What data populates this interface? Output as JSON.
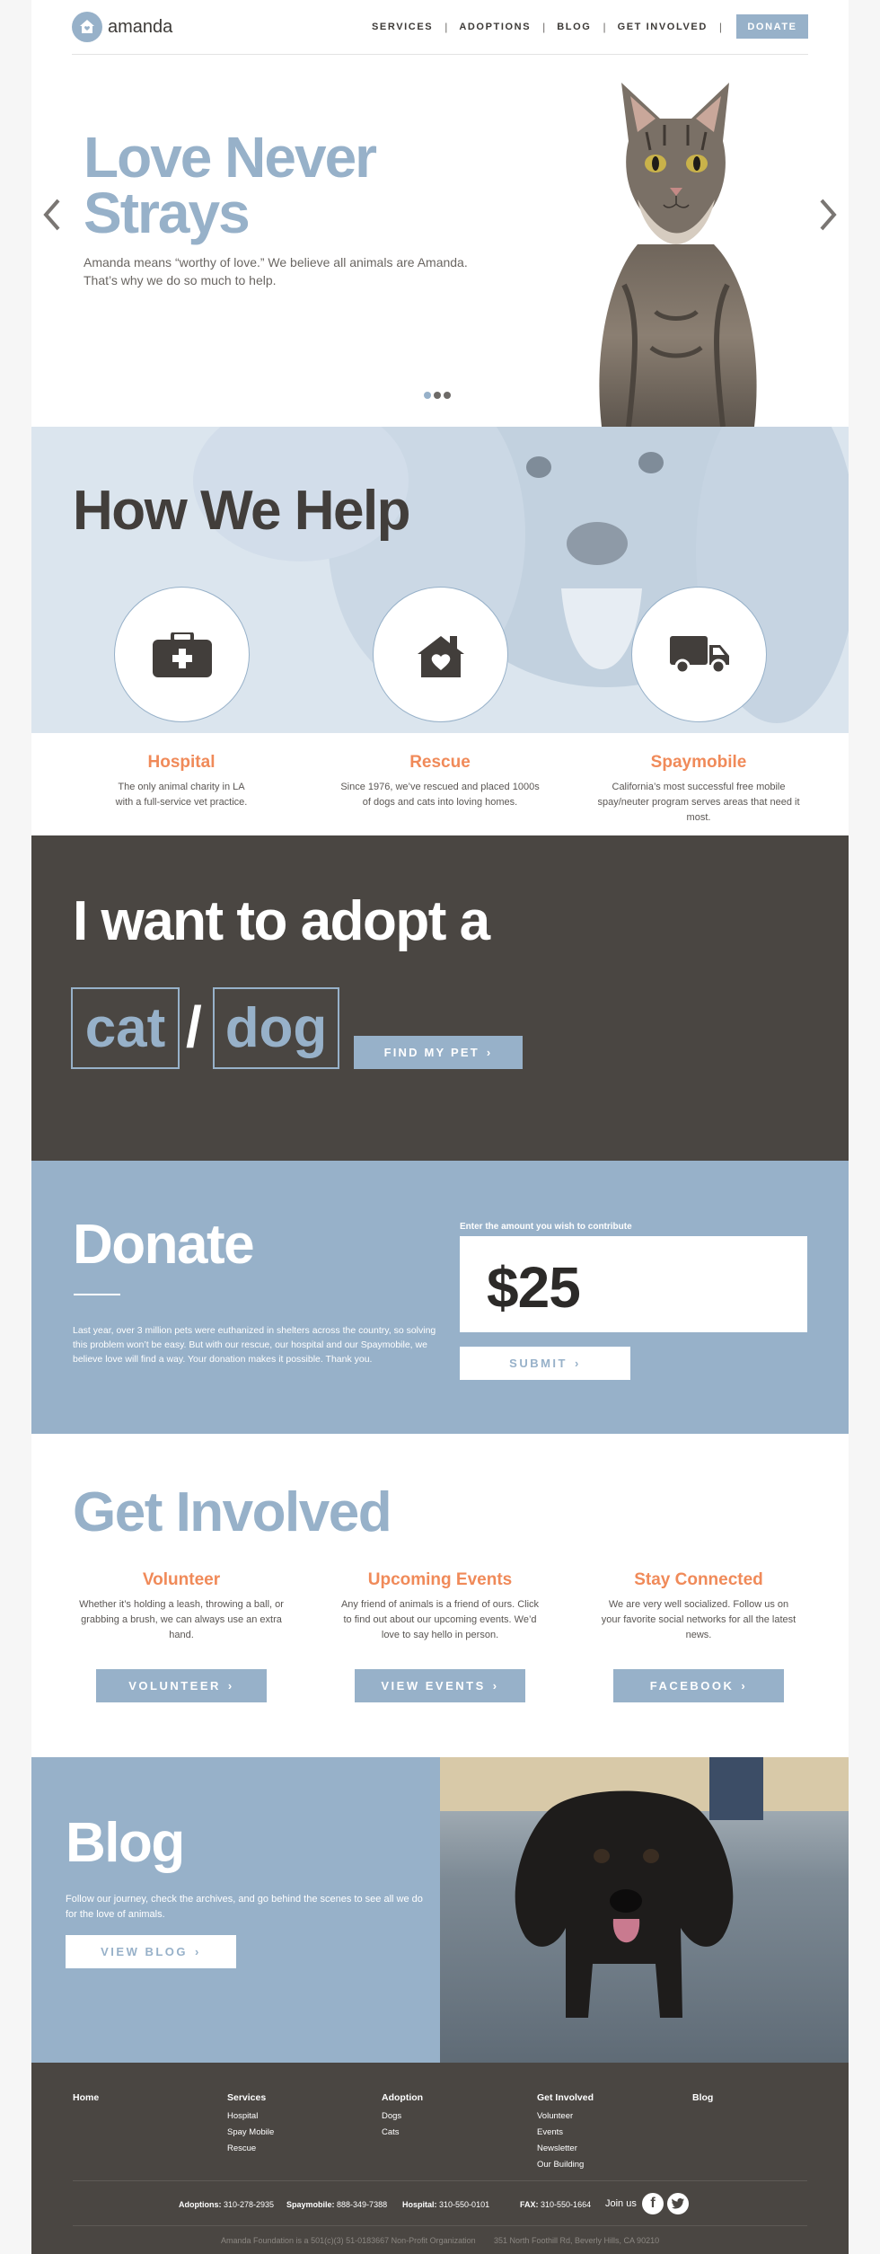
{
  "brand": {
    "name": "amanda",
    "accent": "#97b1c9",
    "orange": "#f08a59",
    "dark": "#4a4642"
  },
  "nav": {
    "items": [
      "SERVICES",
      "ADOPTIONS",
      "BLOG",
      "GET INVOLVED"
    ],
    "donate": "DONATE"
  },
  "hero": {
    "title_line1": "Love Never",
    "title_line2": "Strays",
    "subtitle": "Amanda means “worthy of love.” We believe all animals are Amanda. That’s why we do so much to help.",
    "slides": 3,
    "active_slide": 1
  },
  "help": {
    "title": "How We Help",
    "items": [
      {
        "title": "Hospital",
        "text": "The only animal charity in LA with a full-service vet practice.",
        "icon": "medical-kit-icon"
      },
      {
        "title": "Rescue",
        "text": "Since 1976, we’ve rescued and placed 1000s of dogs and cats into loving homes.",
        "icon": "house-heart-icon"
      },
      {
        "title": "Spaymobile",
        "text": "California’s most successful free mobile spay/neuter program serves areas that need it most.",
        "icon": "truck-icon"
      }
    ]
  },
  "adopt": {
    "title": "I want to adopt a",
    "cat": "cat",
    "slash": "/",
    "dog": "dog",
    "button": "FIND MY PET"
  },
  "donate": {
    "title": "Donate",
    "text": "Last year, over 3 million pets were euthanized in shelters across the country, so solving this problem won’t be easy. But with our rescue, our hospital and our Spaymobile, we believe love will find a way. Your donation makes it possible. Thank you.",
    "amount_label": "Enter the amount you wish to contribute",
    "amount": "$25",
    "submit": "SUBMIT"
  },
  "involved": {
    "title": "Get Involved",
    "columns": [
      {
        "title": "Volunteer",
        "text": "Whether it’s holding a leash, throwing a ball, or grabbing a brush, we can always use an extra hand.",
        "button": "VOLUNTEER"
      },
      {
        "title": "Upcoming Events",
        "text": "Any friend of animals is a friend of ours. Click to find out about our upcoming events. We’d love to say hello in person.",
        "button": "VIEW EVENTS"
      },
      {
        "title": "Stay Connected",
        "text": "We are very well socialized. Follow us on your favorite social networks for all the latest news.",
        "button": "FACEBOOK"
      }
    ]
  },
  "blog": {
    "title": "Blog",
    "text": "Follow our journey, check the archives, and go behind the scenes to see all we do for the love of animals.",
    "button": "VIEW BLOG"
  },
  "footer": {
    "columns": [
      {
        "title": "Home",
        "links": []
      },
      {
        "title": "Services",
        "links": [
          "Hospital",
          "Spay Mobile",
          "Rescue"
        ]
      },
      {
        "title": "Adoption",
        "links": [
          "Dogs",
          "Cats"
        ]
      },
      {
        "title": "Get Involved",
        "links": [
          "Volunteer",
          "Events",
          "Newsletter",
          "Our Building"
        ]
      },
      {
        "title": "Blog",
        "links": []
      }
    ],
    "contacts": [
      {
        "label": "Adoptions:",
        "value": "310-278-2935"
      },
      {
        "label": "Spaymobile:",
        "value": "888-349-7388"
      },
      {
        "label": "Hospital:",
        "value": "310-550-0101"
      },
      {
        "label": "FAX:",
        "value": "310-550-1664"
      }
    ],
    "join": "Join us",
    "social": [
      "facebook-icon",
      "twitter-icon"
    ],
    "legal_org": "Amanda Foundation is a 501(c)(3) 51-0183667 Non-Profit Organization",
    "legal_address": "351 North Foothill Rd, Beverly Hills, CA 90210"
  }
}
